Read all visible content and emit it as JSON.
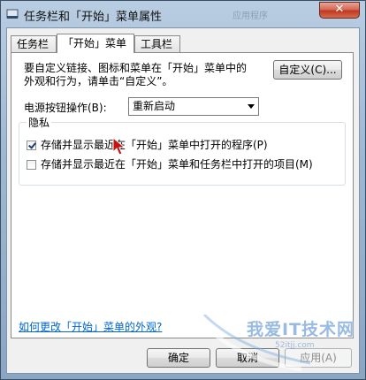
{
  "window": {
    "title": "任务栏和「开始」菜单属性",
    "bg_ghost_text": "应用程序设置",
    "close_symbol": "✕"
  },
  "tabs": [
    {
      "label": "任务栏",
      "active": false
    },
    {
      "label": "「开始」菜单",
      "active": true
    },
    {
      "label": "工具栏",
      "active": false
    }
  ],
  "start_menu": {
    "description_line1": "要自定义链接、图标和菜单在「开始」菜单中的",
    "description_line2": "外观和行为，请单击“自定义”。",
    "customize_button": "自定义(C)...",
    "power_label": "电源按钮操作(B):",
    "power_value": "重新启动",
    "privacy": {
      "title": "隐私",
      "items": [
        {
          "label": "存储并显示最近在「开始」菜单中打开的程序(P)",
          "checked": true
        },
        {
          "label": "存储并显示最近在「开始」菜单和任务栏中打开的项目(M)",
          "checked": false
        }
      ]
    },
    "help_link": "如何更改「开始」菜单的外观?"
  },
  "footer": {
    "ok": "确定",
    "cancel": "取消",
    "apply": "应用(A)"
  },
  "watermark": {
    "text": "我爱IT技术网",
    "sub": "52itjj.com"
  }
}
